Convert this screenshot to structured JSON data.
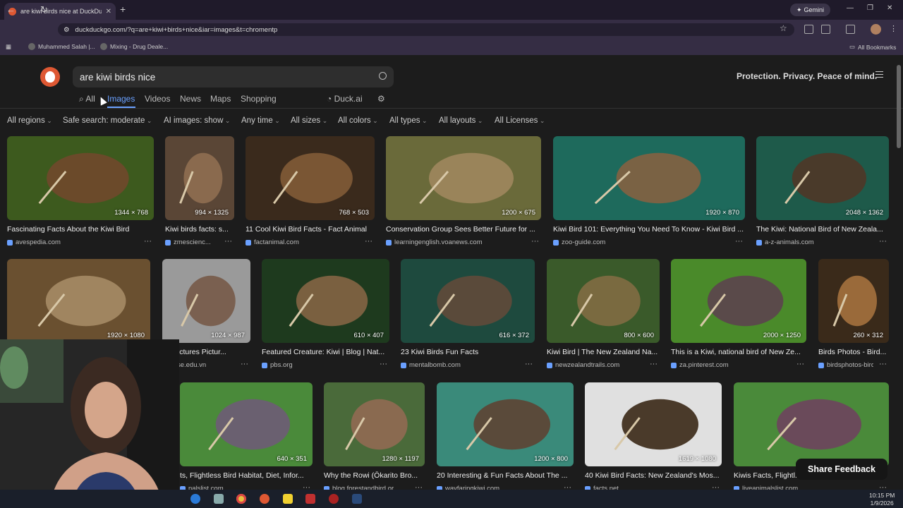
{
  "browser": {
    "tab_title": "are kiwi birds nice at DuckDuck",
    "url": "duckduckgo.com/?q=are+kiwi+birds+nice&iar=images&t=chromentp",
    "gemini_label": "Gemini",
    "bookmarks": [
      "Muhammed Salah |...",
      "Mixing - Drug Deale..."
    ],
    "all_bookmarks": "All Bookmarks"
  },
  "search": {
    "query": "are kiwi birds nice",
    "slogan": "Protection. Privacy. Peace of mind."
  },
  "nav": {
    "all": "All",
    "images": "Images",
    "videos": "Videos",
    "news": "News",
    "maps": "Maps",
    "shopping": "Shopping",
    "duckai": "Duck.ai"
  },
  "filters": [
    "All regions",
    "Safe search: moderate",
    "AI images: show",
    "Any time",
    "All sizes",
    "All colors",
    "All types",
    "All layouts",
    "All Licenses"
  ],
  "results": [
    {
      "title": "Fascinating Facts About the Kiwi Bird",
      "source": "avespedia.com",
      "dims": "1344 × 768"
    },
    {
      "title": "Kiwi birds facts: s...",
      "source": "zmescienc...",
      "dims": "994 × 1325"
    },
    {
      "title": "11 Cool Kiwi Bird Facts - Fact Animal",
      "source": "factanimal.com",
      "dims": "768 × 503"
    },
    {
      "title": "Conservation Group Sees Better Future for ...",
      "source": "learningenglish.voanews.com",
      "dims": "1200 × 675"
    },
    {
      "title": "Kiwi Bird 101: Everything You Need To Know - Kiwi Bird ...",
      "source": "zoo-guide.com",
      "dims": "1920 × 870"
    },
    {
      "title": "The Kiwi: National Bird of New Zeala...",
      "source": "a-z-animals.com",
      "dims": "2048 × 1362"
    },
    {
      "title": "",
      "source": "",
      "dims": "1920 × 1080"
    },
    {
      "title": "2+ Pictures Pictur...",
      "source": "wise.edu.vn",
      "dims": "1024 × 987"
    },
    {
      "title": "Featured Creature: Kiwi | Blog | Nat...",
      "source": "pbs.org",
      "dims": "610 × 407"
    },
    {
      "title": "23 Kiwi Birds Fun Facts",
      "source": "mentalbomb.com",
      "dims": "616 × 372"
    },
    {
      "title": "Kiwi Bird | The New Zealand Na...",
      "source": "newzealandtrails.com",
      "dims": "800 × 600"
    },
    {
      "title": "This is a Kiwi, national bird of New Ze...",
      "source": "za.pinterest.com",
      "dims": "2000 × 1250"
    },
    {
      "title": "Birds Photos - Bird...",
      "source": "birdsphotos-birdswallpa...",
      "dims": "260 × 312"
    },
    {
      "title": "ts, Flightless Bird Habitat, Diet, Infor...",
      "source": "nalslist.com",
      "dims": "640 × 351"
    },
    {
      "title": "Why the Rowi (Ōkarito Bro...",
      "source": "blog.forestandbird.or...",
      "dims": "1280 × 1197"
    },
    {
      "title": "20 Interesting & Fun Facts About The ...",
      "source": "wayfaringkiwi.com",
      "dims": "1200 × 800"
    },
    {
      "title": "40 Kiwi Bird Facts: New Zealand's Mos...",
      "source": "facts.net",
      "dims": "1619 × 1080"
    },
    {
      "title": "Kiwis Facts, Flightl...",
      "source": "liveanimalslist.com",
      "dims": ""
    }
  ],
  "share_feedback": "Share Feedback",
  "clock": {
    "time": "10:15 PM",
    "date": "1/9/2026"
  },
  "colors": {
    "accent": "#6aa0ff",
    "brand": "#de5833"
  }
}
